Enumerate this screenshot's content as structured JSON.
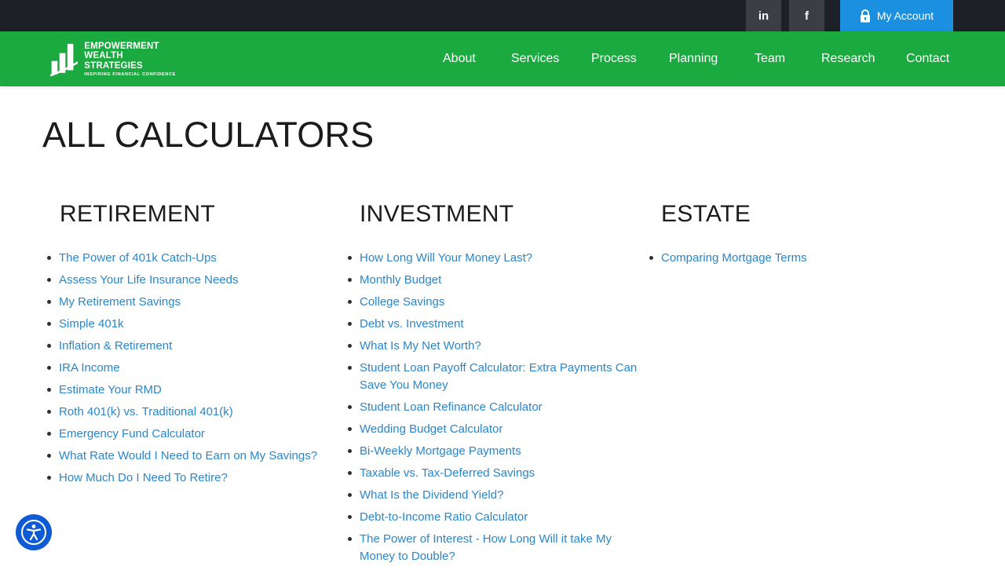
{
  "topbar": {
    "linkedin_label": "in",
    "facebook_label": "f",
    "account_label": "My Account",
    "colors": {
      "bar": "#1d2027",
      "social": "#3b3e45",
      "account": "#1b8fe0"
    }
  },
  "header": {
    "logo_lines": [
      "EMPOWERMENT",
      "WEALTH",
      "STRATEGIES"
    ],
    "logo_tagline": "INSPIRING FINANCIAL CONFIDENCE",
    "nav": [
      "About",
      "Services",
      "Process",
      "Planning",
      "Team",
      "Research",
      "Contact"
    ],
    "color": "#1aaa3f"
  },
  "main": {
    "title": "ALL CALCULATORS",
    "columns": [
      {
        "heading": "RETIREMENT",
        "items": [
          "The Power of 401k Catch-Ups",
          "Assess Your Life Insurance Needs",
          "My Retirement Savings",
          "Simple 401k",
          "Inflation & Retirement",
          "IRA Income",
          "Estimate Your RMD",
          "Roth 401(k) vs. Traditional 401(k)",
          "Emergency Fund Calculator",
          "What Rate Would I Need to Earn on My Savings?",
          "How Much Do I Need To Retire?"
        ]
      },
      {
        "heading": "INVESTMENT",
        "items": [
          "How Long Will Your Money Last?",
          "Monthly Budget",
          "College Savings",
          "Debt vs. Investment",
          "What Is My Net Worth?",
          "Student Loan Payoff Calculator: Extra Payments Can Save You Money",
          "Student Loan Refinance Calculator",
          "Wedding Budget Calculator",
          "Bi-Weekly Mortgage Payments",
          "Taxable vs. Tax-Deferred Savings",
          "What Is the Dividend Yield?",
          "Debt-to-Income Ratio Calculator",
          "The Power of Interest - How Long Will it take My Money to Double?"
        ]
      },
      {
        "heading": "ESTATE",
        "items": [
          "Comparing Mortgage Terms"
        ]
      }
    ],
    "link_color": "#2a86c8"
  },
  "accessibility": {
    "icon": "accessibility-icon",
    "color": "#0e5bd3"
  }
}
